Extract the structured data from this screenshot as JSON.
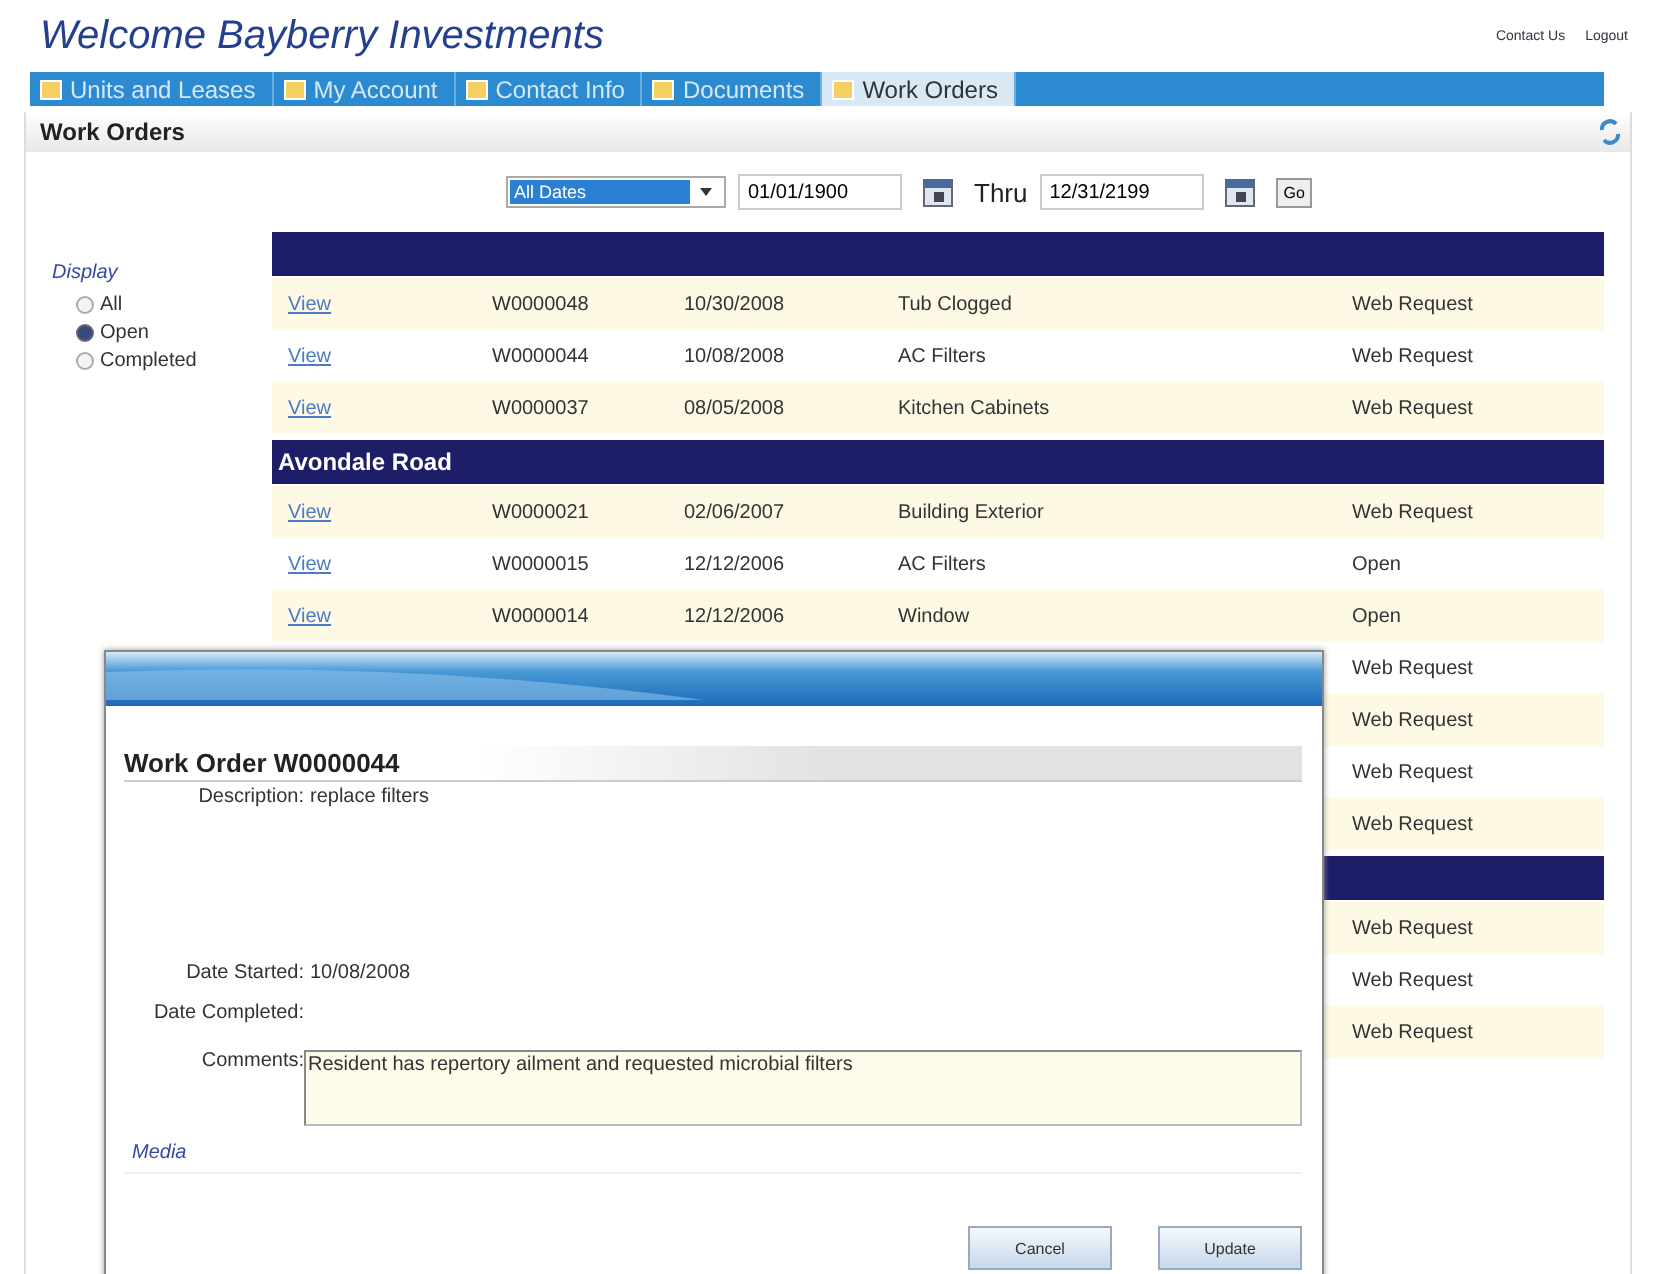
{
  "header": {
    "title": "Welcome Bayberry Investments",
    "links": [
      "Contact Us",
      "Logout"
    ]
  },
  "nav_tabs": [
    {
      "label": "Units and Leases",
      "selected": false
    },
    {
      "label": "My Account",
      "selected": false
    },
    {
      "label": "Contact Info",
      "selected": false
    },
    {
      "label": "Documents",
      "selected": false
    },
    {
      "label": "Work Orders",
      "selected": true
    }
  ],
  "section_title": "Work Orders",
  "filter": {
    "date_range": "All Dates",
    "from": "01/01/1900",
    "thru_label": "Thru",
    "to": "12/31/2199",
    "go_button": "Go"
  },
  "display": {
    "label": "Display",
    "options": [
      {
        "label": "All",
        "selected": false
      },
      {
        "label": "Open",
        "selected": true
      },
      {
        "label": "Completed",
        "selected": false
      }
    ]
  },
  "table": {
    "rows": [
      {
        "kind": "group"
      },
      {
        "kind": "row",
        "link": "View",
        "number": "W0000048",
        "date": "10/30/2008",
        "description": "Tub Clogged",
        "status": "Web Request"
      },
      {
        "kind": "row",
        "link": "View",
        "number": "W0000044",
        "date": "10/08/2008",
        "description": "AC Filters",
        "status": "Web Request"
      },
      {
        "kind": "row",
        "link": "View",
        "number": "W0000037",
        "date": "08/05/2008",
        "description": "Kitchen Cabinets",
        "status": "Web Request"
      },
      {
        "kind": "group",
        "title": "Avondale Road"
      },
      {
        "kind": "row",
        "link": "View",
        "number": "W0000021",
        "date": "02/06/2007",
        "description": "Building Exterior",
        "status": "Web Request"
      },
      {
        "kind": "row",
        "link": "View",
        "number": "W0000015",
        "date": "12/12/2006",
        "description": "AC Filters",
        "status": "Open"
      },
      {
        "kind": "row",
        "link": "View",
        "number": "W0000014",
        "date": "12/12/2006",
        "description": "Window",
        "status": "Open"
      },
      {
        "kind": "row",
        "status": "Web Request"
      },
      {
        "kind": "row",
        "status": "Web Request"
      },
      {
        "kind": "row",
        "status": "Web Request"
      },
      {
        "kind": "row",
        "status": "Web Request"
      },
      {
        "kind": "group"
      },
      {
        "kind": "row",
        "status": "Web Request"
      },
      {
        "kind": "row",
        "status": "Web Request"
      },
      {
        "kind": "row",
        "status": "Web Request"
      }
    ]
  },
  "dialog": {
    "title": "Work Order W0000044",
    "description_label": "Description:",
    "description": "replace filters",
    "date_started_label": "Date Started:",
    "date_started": "10/08/2008",
    "date_completed_label": "Date Completed:",
    "comments_label": "Comments:",
    "comments": "Resident has repertory ailment and requested microbial filters",
    "media_label": "Media",
    "buttons": [
      "Cancel",
      "Update"
    ]
  }
}
